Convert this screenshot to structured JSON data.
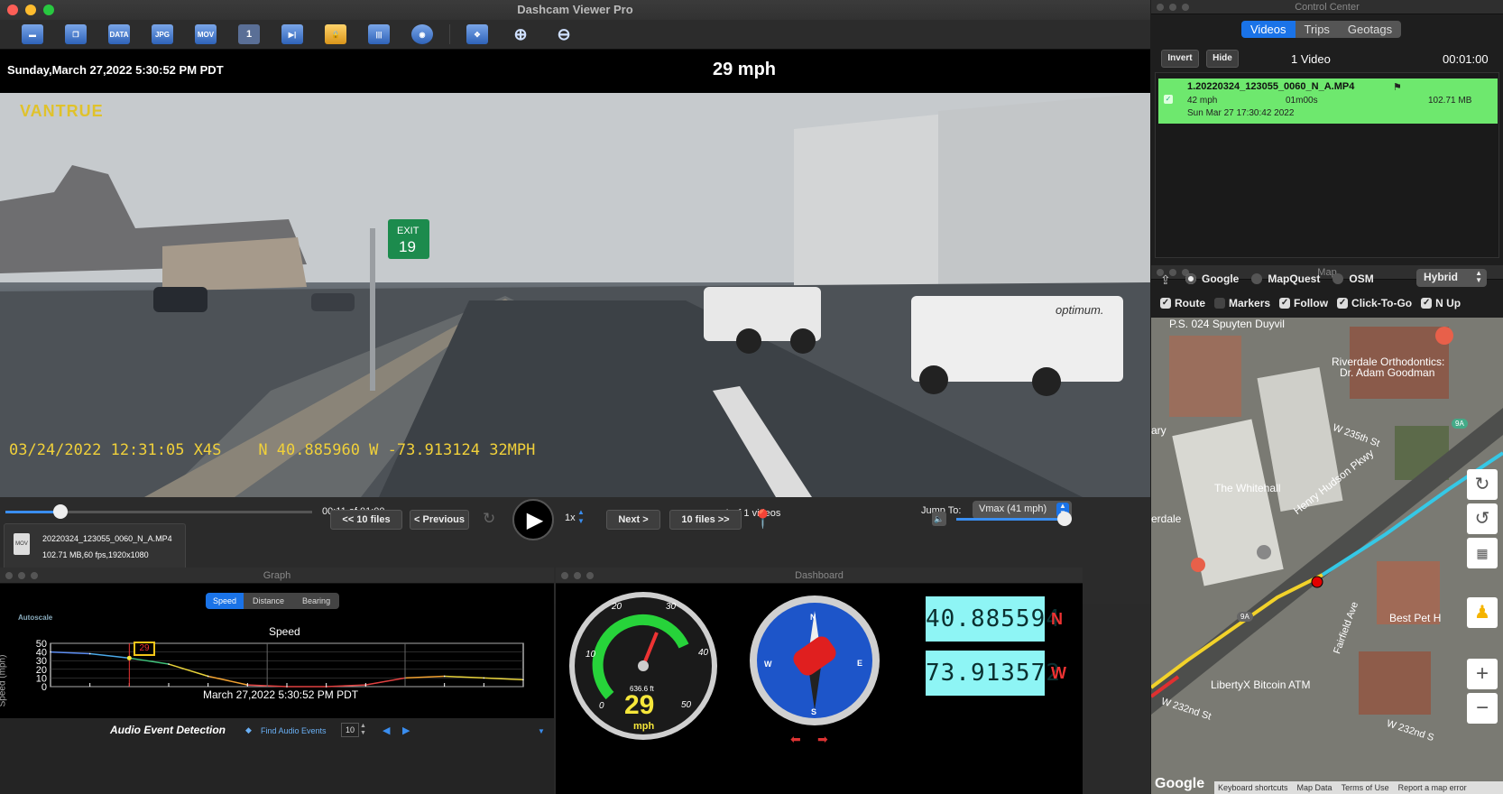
{
  "app": {
    "title": "Dashcam Viewer Pro",
    "toolbar_icons": [
      "open-folder",
      "copy",
      "data-export",
      "jpg-export",
      "mov-export",
      "single-view",
      "timeline",
      "lock",
      "audio",
      "record",
      "fullscreen",
      "zoom-in",
      "zoom-out"
    ],
    "toolbar_labels": {
      "data": "DATA",
      "jpg": "JPG",
      "mov": "MOV",
      "one": "1"
    }
  },
  "infobar": {
    "datetime": "Sunday,March 27,2022 5:30:52 PM PDT",
    "speed": "29 mph"
  },
  "video": {
    "brand": "VANTRUE",
    "overlay": "03/24/2022 12:31:05 X4S    N 40.885960 W -73.913124 32MPH",
    "exit_sign": "EXIT",
    "exit_number": "19",
    "truck_text": "optimum."
  },
  "playback": {
    "time": "00:11 of 01:00",
    "progress": 0.18,
    "video_count": "1 of 1 videos",
    "jump_label": "Jump To:",
    "jump_value": "Vmax (41 mph)",
    "file_name": "20220324_123055_0060_N_A.MP4",
    "file_info": "102.71 MB,60 fps,1920x1080",
    "btn_prev10": "<< 10 files",
    "btn_prev": "< Previous",
    "rate": "1x",
    "btn_next": "Next >",
    "btn_next10": "10 files >>",
    "volume": 0.95
  },
  "graph": {
    "panel_title": "Graph",
    "tabs": [
      "Speed",
      "Distance",
      "Bearing"
    ],
    "active_tab": "Speed",
    "autoscale": "Autoscale",
    "title": "Speed",
    "ylabel": "Speed (mph)",
    "y_ticks": [
      "50",
      "40",
      "30",
      "20",
      "10",
      "0"
    ],
    "marker_value": "29",
    "timestamp": "March 27,2022 5:30:52 PM PDT",
    "audio_label": "Audio Event Detection",
    "find_label": "Find Audio Events",
    "threshold": "10"
  },
  "chart_data": {
    "type": "line",
    "title": "Speed",
    "ylabel": "Speed (mph)",
    "ylim": [
      0,
      50
    ],
    "x": [
      0,
      5,
      10,
      15,
      20,
      25,
      30,
      35,
      40,
      45,
      50,
      55,
      60
    ],
    "series": [
      {
        "values": [
          40,
          38,
          33,
          26,
          12,
          2,
          0,
          0,
          2,
          10,
          12,
          10,
          8
        ]
      }
    ]
  },
  "dashboard": {
    "panel_title": "Dashboard",
    "gauge_ticks": [
      "0",
      "10",
      "20",
      "30",
      "40",
      "50"
    ],
    "odometer": "636.6 ft",
    "speed": "29",
    "unit": "mph",
    "compass": {
      "n": "N",
      "s": "S",
      "e": "E",
      "w": "W"
    },
    "lat": "40.885594",
    "lat_dir": "N",
    "lon": "73.913572",
    "lon_dir": "W"
  },
  "control_center": {
    "title": "Control Center",
    "tabs": [
      "Videos",
      "Trips",
      "Geotags"
    ],
    "active_tab": "Videos",
    "invert": "Invert",
    "hide": "Hide",
    "count": "1 Video",
    "duration": "00:01:00",
    "video": {
      "name": "1.20220324_123055_0060_N_A.MP4",
      "speed": "42 mph",
      "length": "01m00s",
      "size": "102.71 MB",
      "date": "Sun Mar 27 17:30:42 2022"
    }
  },
  "map": {
    "title": "Map",
    "providers": [
      "Google",
      "MapQuest",
      "OSM"
    ],
    "active_provider": "Google",
    "type": "Hybrid",
    "options": [
      "Route",
      "Markers",
      "Follow",
      "Click-To-Go",
      "N Up"
    ],
    "checked": [
      true,
      false,
      true,
      true,
      true
    ],
    "labels": {
      "school": "P.S. 024 Spuyten Duyvil",
      "ortho": "Riverdale Orthodontics:",
      "ortho2": "Dr. Adam Goodman",
      "street1": "W 235th St",
      "whitehall": "The Whitehall",
      "parkway": "Henry Hudson Pkwy",
      "dale": "erdale",
      "ary": "ary",
      "fairfield": "Fairfield Ave",
      "bestpet": "Best Pet H",
      "atm": "LibertyX Bitcoin ATM",
      "street2": "W 232nd St",
      "street3": "W 232nd S",
      "route9a": "9A",
      "route9a2": "9A"
    },
    "footer": [
      "Keyboard shortcuts",
      "Map Data",
      "Terms of Use",
      "Report a map error"
    ],
    "google": "Google"
  }
}
